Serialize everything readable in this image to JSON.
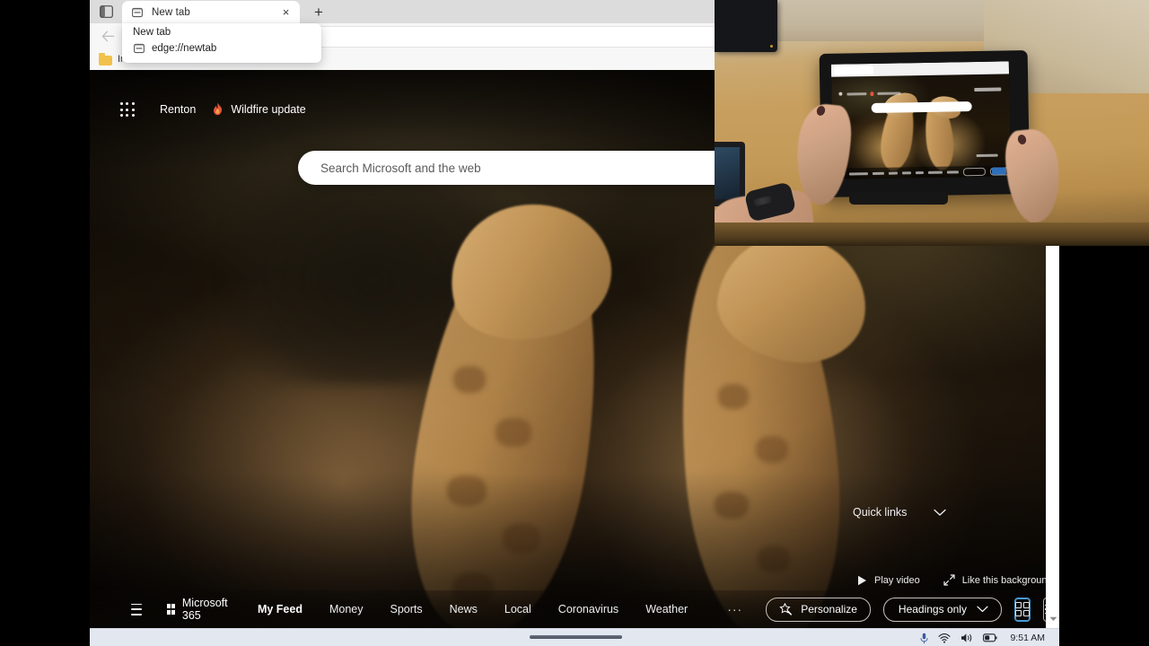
{
  "browser": {
    "tab_strip": {
      "window_tile_icon": "window-tile-icon",
      "tabs": [
        {
          "title": "New tab",
          "favicon": "newtab-icon",
          "close_label": "×"
        }
      ],
      "new_tab_label": "+"
    },
    "tab_preview": {
      "title": "New tab",
      "url": "edge://newtab",
      "favicon": "newtab-icon"
    },
    "address_bar": {
      "back_icon": "back-arrow-icon",
      "value": "",
      "placeholder": ""
    },
    "bookmarks_bar": {
      "items": [
        {
          "label": "In",
          "icon": "folder-icon"
        }
      ]
    }
  },
  "new_tab_page": {
    "top_bar": {
      "app_launcher_icon": "waffle-grid-icon",
      "location": "Renton",
      "alert_icon": "flame-icon",
      "alert_text": "Wildfire update"
    },
    "search": {
      "placeholder": "Search Microsoft and the web",
      "value": ""
    },
    "quick_links": {
      "label": "Quick links",
      "chevron_icon": "chevron-down-icon"
    },
    "background_controls": [
      {
        "label": "Play video",
        "icon": "play-icon"
      },
      {
        "label": "Like this background?",
        "icon": "expand-arrows-icon"
      }
    ],
    "bottom_nav": {
      "menu_icon": "hamburger-icon",
      "brand": "Microsoft 365",
      "brand_icon": "microsoft-logo-icon",
      "links": [
        {
          "label": "My Feed",
          "active": true
        },
        {
          "label": "Money",
          "active": false
        },
        {
          "label": "Sports",
          "active": false
        },
        {
          "label": "News",
          "active": false
        },
        {
          "label": "Local",
          "active": false
        },
        {
          "label": "Coronavirus",
          "active": false
        },
        {
          "label": "Weather",
          "active": false
        }
      ],
      "more_label": "···",
      "personalize_label": "Personalize",
      "personalize_icon": "star-pen-icon",
      "layout_select": {
        "value": "Headings only",
        "chevron_icon": "chevron-down-icon"
      },
      "view_grid_icon": "grid-view-icon",
      "view_list_icon": "list-view-icon",
      "grid_selected": true
    },
    "scrollbar": {
      "down_arrow_icon": "scroll-down-arrow-icon"
    }
  },
  "video_overlay": {
    "description": "picture-in-picture-video",
    "scene": "hands-holding-tablet-on-desk"
  },
  "taskbar": {
    "tray": [
      {
        "icon": "microphone-icon"
      },
      {
        "icon": "wifi-icon"
      },
      {
        "icon": "speaker-icon"
      },
      {
        "icon": "battery-icon"
      }
    ],
    "clock": "9:51 AM"
  },
  "colors": {
    "accent_blue": "#4a9ad4",
    "flame": "#e2553a",
    "folder": "#f2c14b",
    "taskbar_bg": "#e3e7f0"
  }
}
